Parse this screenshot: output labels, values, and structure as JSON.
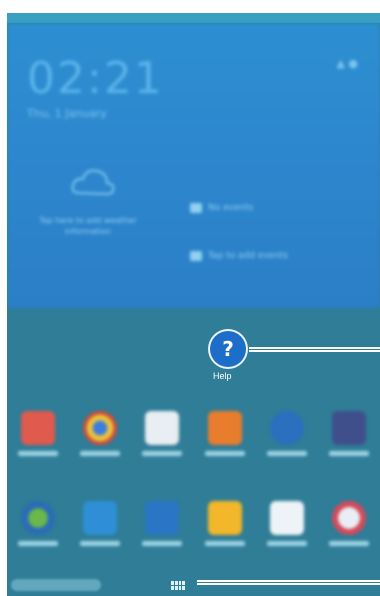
{
  "widget": {
    "clock": "02:21",
    "date_text": "Thu, 1 January",
    "weather_text": "Tap here to add weather information",
    "row_1": "No events",
    "row_2": "Tap to add events"
  },
  "help": {
    "icon_glyph": "?",
    "label": "Help"
  },
  "apps_row_1": [
    "calendar-icon",
    "chrome-icon",
    "play-store-icon",
    "contacts-icon",
    "internet-icon",
    "gallery-icon"
  ],
  "apps_row_2": [
    "maps-icon",
    "samsung-apps-icon",
    "settings-icon",
    "my-files-icon",
    "dropbox-icon",
    "games-icon"
  ],
  "colors": {
    "background": "#2f7d97",
    "help_button": "#1c6ec9",
    "widget": "#2c8fd0"
  }
}
